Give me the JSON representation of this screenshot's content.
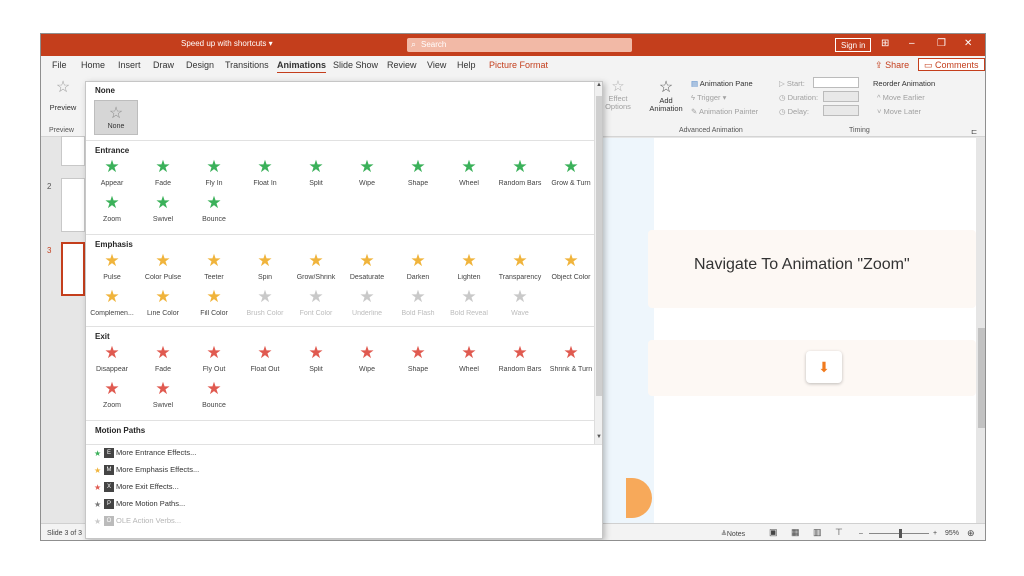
{
  "titlebar": {
    "tip": "Speed up with shortcuts",
    "search_label": "Search",
    "signin": "Sign in",
    "window_buttons": [
      "⊞",
      "–",
      "❐",
      "✕"
    ]
  },
  "menu": {
    "tabs": [
      "File",
      "Home",
      "Insert",
      "Draw",
      "Design",
      "Transitions",
      "Animations",
      "Slide Show",
      "Review",
      "View",
      "Help",
      "Picture Format"
    ],
    "active": "Animations",
    "share": "Share",
    "comments": "Comments"
  },
  "ribbon": {
    "preview": {
      "label": "Preview",
      "group": "Preview"
    },
    "effect_options": "Effect Options",
    "add_animation": "Add Animation",
    "animation_pane": "Animation Pane",
    "trigger": "Trigger",
    "animation_painter": "Animation Painter",
    "advanced_group": "Advanced Animation",
    "start": "Start:",
    "duration": "Duration:",
    "delay": "Delay:",
    "timing_group": "Timing",
    "reorder": "Reorder Animation",
    "move_earlier": "Move Earlier",
    "move_later": "Move Later"
  },
  "gallery": {
    "none_section": "None",
    "none_item": "None",
    "entrance": {
      "title": "Entrance",
      "items": [
        "Appear",
        "Fade",
        "Fly In",
        "Float In",
        "Split",
        "Wipe",
        "Shape",
        "Wheel",
        "Random Bars",
        "Grow & Turn",
        "Zoom",
        "Swivel",
        "Bounce"
      ]
    },
    "emphasis": {
      "title": "Emphasis",
      "items": [
        "Pulse",
        "Color Pulse",
        "Teeter",
        "Spin",
        "Grow/Shrink",
        "Desaturate",
        "Darken",
        "Lighten",
        "Transparency",
        "Object Color",
        "Complemen...",
        "Line Color",
        "Fill Color",
        "Brush Color",
        "Font Color",
        "Underline",
        "Bold Flash",
        "Bold Reveal",
        "Wave"
      ],
      "disabled_from": 13
    },
    "exit": {
      "title": "Exit",
      "items": [
        "Disappear",
        "Fade",
        "Fly Out",
        "Float Out",
        "Split",
        "Wipe",
        "Shape",
        "Wheel",
        "Random Bars",
        "Shrink & Turn",
        "Zoom",
        "Swivel",
        "Bounce"
      ]
    },
    "motion": {
      "title": "Motion Paths"
    },
    "more": [
      {
        "label": "More Entrance Effects...",
        "key": "E"
      },
      {
        "label": "More Emphasis Effects...",
        "key": "M"
      },
      {
        "label": "More Exit Effects...",
        "key": "X"
      },
      {
        "label": "More Motion Paths...",
        "key": "P"
      },
      {
        "label": "OLE Action Verbs...",
        "key": "O"
      }
    ]
  },
  "slides": {
    "numbers": [
      "2",
      "3"
    ]
  },
  "slide": {
    "title": "Navigate To Animation \"Zoom\"",
    "arrow": "⬇"
  },
  "status": {
    "slide_count": "Slide 3 of 3",
    "notes": "Notes",
    "zoom": "95%"
  }
}
